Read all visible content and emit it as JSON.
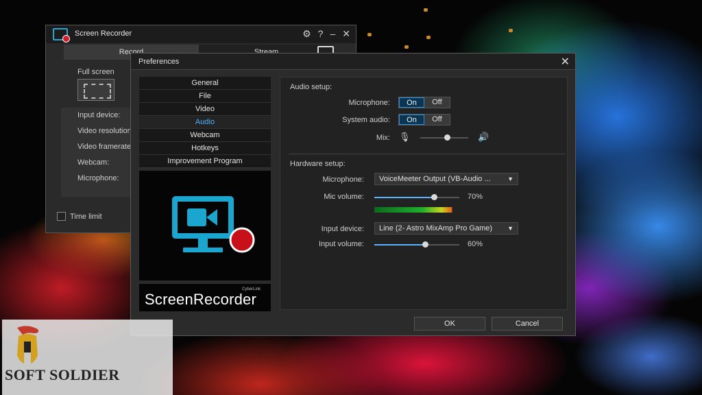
{
  "back_window": {
    "title": "Screen Recorder",
    "tabs": [
      "Record",
      "Stream"
    ],
    "fullscreen_label": "Full screen",
    "info_rows": [
      "Input device:",
      "Video resolution:",
      "Video framerate:",
      "Webcam:",
      "Microphone:"
    ],
    "time_limit": "Time limit"
  },
  "preferences": {
    "title": "Preferences",
    "nav": [
      "General",
      "File",
      "Video",
      "Audio",
      "Webcam",
      "Hotkeys",
      "Improvement Program"
    ],
    "active_nav": "Audio",
    "brand_small": "CyberLink",
    "brand_big": "ScreenRecorder",
    "audio_setup": {
      "title": "Audio setup:",
      "microphone_label": "Microphone:",
      "system_audio_label": "System audio:",
      "on": "On",
      "off": "Off",
      "mix_label": "Mix:",
      "mix_level": 0.55
    },
    "hardware_setup": {
      "title": "Hardware setup:",
      "microphone_label": "Microphone:",
      "microphone_value": "VoiceMeeter Output (VB-Audio ...",
      "mic_volume_label": "Mic volume:",
      "mic_volume": "70%",
      "input_device_label": "Input device:",
      "input_device_value": "Line (2- Astro MixAmp Pro Game)",
      "input_volume_label": "Input volume:",
      "input_volume": "60%"
    },
    "ok": "OK",
    "cancel": "Cancel"
  },
  "watermark": "SOFT SOLDIER",
  "colors": {
    "accent": "#2d8fd6",
    "logo_blue": "#1aa6cf",
    "record_red": "#c8101a"
  }
}
